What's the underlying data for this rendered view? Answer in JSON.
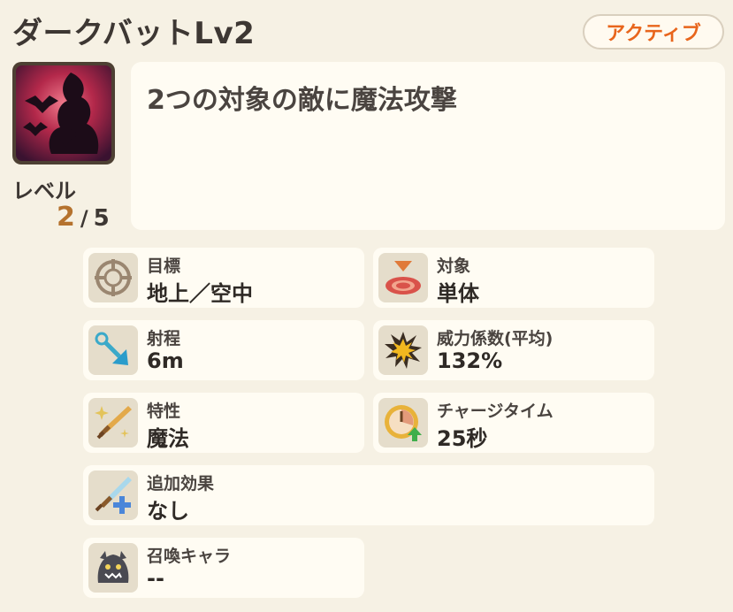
{
  "skill": {
    "name": "ダークバットLv2",
    "type_badge": "アクティブ",
    "description": "2つの対象の敵に魔法攻撃",
    "level_label": "レベル",
    "level_current": "2",
    "level_separator": "/",
    "level_max": "5",
    "icon": "dark-bat-skill-icon"
  },
  "stats": [
    {
      "label": "目標",
      "value": "地上／空中",
      "icon": "crosshair-icon"
    },
    {
      "label": "対象",
      "value": "単体",
      "icon": "target-marker-icon"
    },
    {
      "label": "射程",
      "value": "6m",
      "icon": "range-arrow-icon"
    },
    {
      "label": "威力係数(平均)",
      "value": "132%",
      "icon": "explosion-icon"
    },
    {
      "label": "特性",
      "value": "魔法",
      "icon": "sword-sparkle-icon"
    },
    {
      "label": "チャージタイム",
      "value": "25秒",
      "icon": "clock-up-icon"
    },
    {
      "label": "追加効果",
      "value": "なし",
      "icon": "sword-plus-icon"
    },
    {
      "label": "召喚キャラ",
      "value": "--",
      "icon": "summon-creature-icon"
    }
  ],
  "colors": {
    "badge_text": "#e8651c",
    "level_current": "#b5722e",
    "background": "#f6f1e4",
    "card": "#fffcf3",
    "icon_bg": "#e5ddcb"
  }
}
